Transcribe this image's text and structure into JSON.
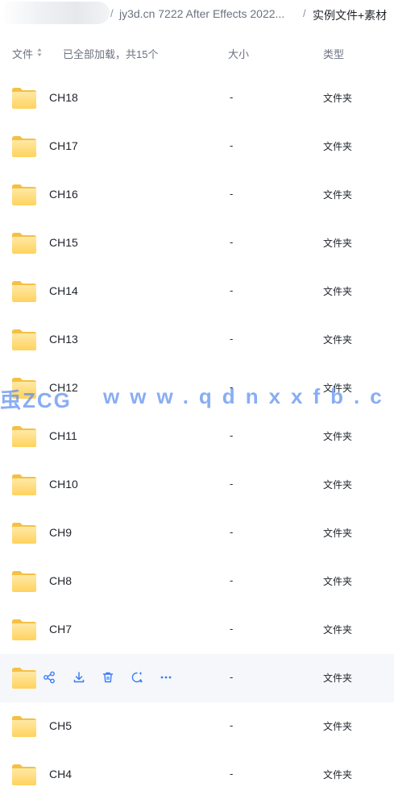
{
  "breadcrumb": {
    "separator": "/",
    "parent": "jy3d.cn 7222 After Effects 2022...",
    "current": "实例文件+素材"
  },
  "header": {
    "name": "文件",
    "status": "已全部加载，共15个",
    "size": "大小",
    "type": "类型"
  },
  "rows": [
    {
      "name": "CH18",
      "size": "-",
      "type": "文件夹"
    },
    {
      "name": "CH17",
      "size": "-",
      "type": "文件夹"
    },
    {
      "name": "CH16",
      "size": "-",
      "type": "文件夹"
    },
    {
      "name": "CH15",
      "size": "-",
      "type": "文件夹"
    },
    {
      "name": "CH14",
      "size": "-",
      "type": "文件夹"
    },
    {
      "name": "CH13",
      "size": "-",
      "type": "文件夹"
    },
    {
      "name": "CH12",
      "size": "-",
      "type": "文件夹"
    },
    {
      "name": "CH11",
      "size": "-",
      "type": "文件夹"
    },
    {
      "name": "CH10",
      "size": "-",
      "type": "文件夹"
    },
    {
      "name": "CH9",
      "size": "-",
      "type": "文件夹"
    },
    {
      "name": "CH8",
      "size": "-",
      "type": "文件夹"
    },
    {
      "name": "CH7",
      "size": "-",
      "type": "文件夹"
    },
    {
      "name": "",
      "size": "-",
      "type": "文件夹",
      "hover_actions": [
        "share-icon",
        "download-icon",
        "delete-icon",
        "ai-chat-icon",
        "more-icon"
      ]
    },
    {
      "name": "CH5",
      "size": "-",
      "type": "文件夹"
    },
    {
      "name": "CH4",
      "size": "-",
      "type": "文件夹"
    }
  ],
  "watermark": {
    "left": "䖝ZCG",
    "right": "www.qdnxxfb.c"
  },
  "colors": {
    "folder_top": "#ffe9a6",
    "folder_bottom": "#ffd25e",
    "accent": "#3b7cf5",
    "hover_row": "#f5f7fb",
    "watermark": "#5b8ef0"
  }
}
